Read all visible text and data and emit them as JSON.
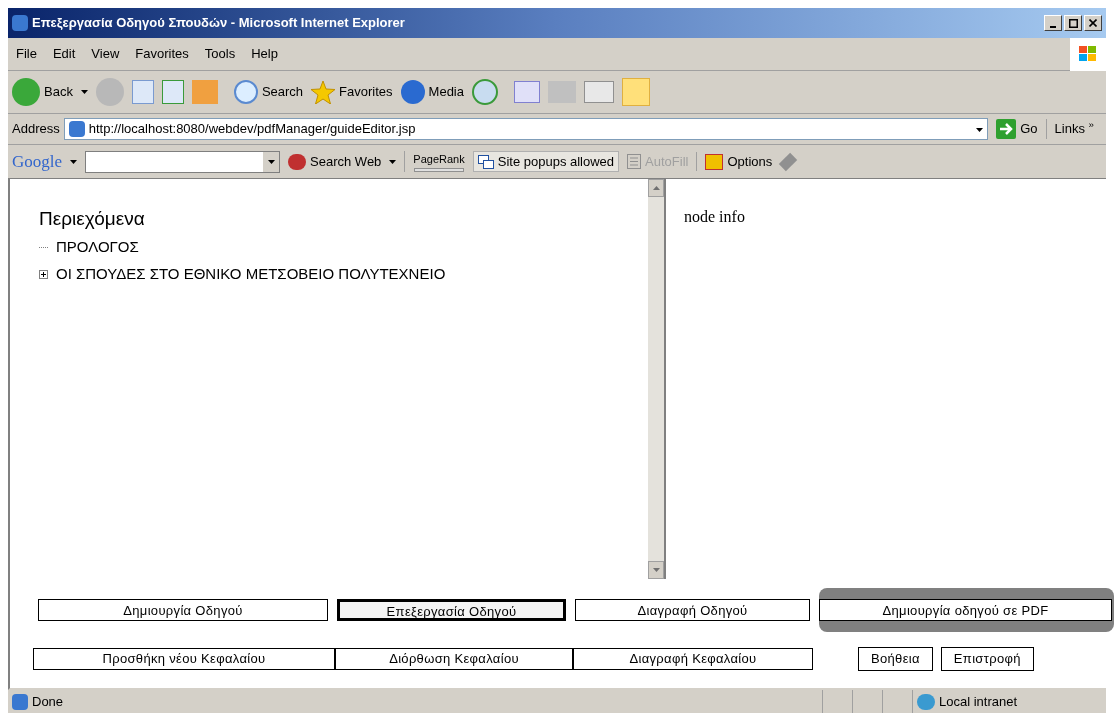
{
  "window": {
    "title": "Επεξεργασία Οδηγού Σπουδών - Microsoft Internet Explorer"
  },
  "menu": [
    "File",
    "Edit",
    "View",
    "Favorites",
    "Tools",
    "Help"
  ],
  "toolbar": {
    "back": "Back",
    "search": "Search",
    "favorites": "Favorites",
    "media": "Media"
  },
  "address": {
    "label": "Address",
    "value": "http://localhost:8080/webdev/pdfManager/guideEditor.jsp",
    "go": "Go",
    "links": "Links",
    "more": "»"
  },
  "google_bar": {
    "logo": "Google",
    "search_web": "Search Web",
    "pagerank": "PageRank",
    "popups": "Site popups allowed",
    "autofill": "AutoFill",
    "options": "Options"
  },
  "tree": {
    "title": "Περιεχόμενα",
    "items": [
      {
        "label": "ΠΡΟΛΟΓΟΣ",
        "has_children": false
      },
      {
        "label": "ΟΙ ΣΠΟΥΔΕΣ ΣΤΟ ΕΘΝΙΚΟ ΜΕΤΣΟΒΕΙΟ ΠΟΛΥΤΕΧΝΕΙΟ",
        "has_children": true
      }
    ]
  },
  "info_panel": {
    "text": "node info"
  },
  "button_rows": [
    [
      {
        "label": "Δημιουργία Οδηγού",
        "selected": false,
        "highlighted": false
      },
      {
        "label": "Επεξεργασία Οδηγού",
        "selected": true,
        "highlighted": false
      },
      {
        "label": "Διαγραφή Οδηγού",
        "selected": false,
        "highlighted": false
      },
      {
        "label": "Δημιουργία οδηγού σε PDF",
        "selected": false,
        "highlighted": true
      }
    ],
    [
      {
        "label": "Προσθήκη νέου Κεφαλαίου",
        "selected": false,
        "highlighted": false
      },
      {
        "label": "Διόρθωση Κεφαλαίου",
        "selected": false,
        "highlighted": false
      },
      {
        "label": "Διαγραφή Κεφαλαίου",
        "selected": false,
        "highlighted": false
      }
    ]
  ],
  "small_buttons": [
    {
      "label": "Βοήθεια"
    },
    {
      "label": "Επιστροφή"
    }
  ],
  "status_bar": {
    "text": "Done",
    "zone": "Local intranet"
  }
}
